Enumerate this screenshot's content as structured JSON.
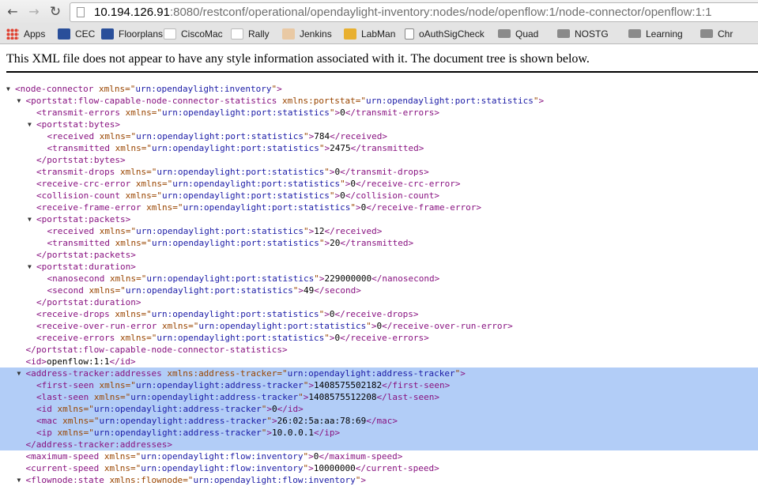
{
  "browser": {
    "url_host": "10.194.126.91",
    "url_rest": ":8080/restconf/operational/opendaylight-inventory:nodes/node/openflow:1/node-connector/openflow:1:1"
  },
  "bookmarks": [
    {
      "label": "Apps",
      "icon": "apps-grid-icon"
    },
    {
      "label": "CEC",
      "icon": "cec-icon"
    },
    {
      "label": "Floorplans",
      "icon": "cec-icon"
    },
    {
      "label": "CiscoMac",
      "icon": "cisco-icon"
    },
    {
      "label": "Rally",
      "icon": "cisco-icon"
    },
    {
      "label": "Jenkins",
      "icon": "jenkins-icon"
    },
    {
      "label": "LabMan",
      "icon": "labman-icon"
    },
    {
      "label": "oAuthSigCheck",
      "icon": "page-icon"
    },
    {
      "label": "Quad",
      "icon": "folder-icon"
    },
    {
      "label": "NOSTG",
      "icon": "folder-icon"
    },
    {
      "label": "Learning",
      "icon": "folder-icon"
    },
    {
      "label": "Chr",
      "icon": "folder-icon"
    }
  ],
  "notice": "This XML file does not appear to have any style information associated with it. The document tree is shown below.",
  "xml_lines": [
    {
      "d": 0,
      "tog": "▼",
      "open": "node-connector",
      "attr": "xmlns",
      "val": "urn:opendaylight:inventory"
    },
    {
      "d": 1,
      "tog": "▼",
      "open": "portstat:flow-capable-node-connector-statistics",
      "attr": "xmlns:portstat",
      "val": "urn:opendaylight:port:statistics"
    },
    {
      "d": 2,
      "open": "transmit-errors",
      "attr": "xmlns",
      "val": "urn:opendaylight:port:statistics",
      "text": "0",
      "close": "transmit-errors"
    },
    {
      "d": 2,
      "tog": "▼",
      "open": "portstat:bytes"
    },
    {
      "d": 3,
      "open": "received",
      "attr": "xmlns",
      "val": "urn:opendaylight:port:statistics",
      "text": "784",
      "close": "received"
    },
    {
      "d": 3,
      "open": "transmitted",
      "attr": "xmlns",
      "val": "urn:opendaylight:port:statistics",
      "text": "2475",
      "close": "transmitted"
    },
    {
      "d": 2,
      "close": "portstat:bytes"
    },
    {
      "d": 2,
      "open": "transmit-drops",
      "attr": "xmlns",
      "val": "urn:opendaylight:port:statistics",
      "text": "0",
      "close": "transmit-drops"
    },
    {
      "d": 2,
      "open": "receive-crc-error",
      "attr": "xmlns",
      "val": "urn:opendaylight:port:statistics",
      "text": "0",
      "close": "receive-crc-error"
    },
    {
      "d": 2,
      "open": "collision-count",
      "attr": "xmlns",
      "val": "urn:opendaylight:port:statistics",
      "text": "0",
      "close": "collision-count"
    },
    {
      "d": 2,
      "open": "receive-frame-error",
      "attr": "xmlns",
      "val": "urn:opendaylight:port:statistics",
      "text": "0",
      "close": "receive-frame-error"
    },
    {
      "d": 2,
      "tog": "▼",
      "open": "portstat:packets"
    },
    {
      "d": 3,
      "open": "received",
      "attr": "xmlns",
      "val": "urn:opendaylight:port:statistics",
      "text": "12",
      "close": "received"
    },
    {
      "d": 3,
      "open": "transmitted",
      "attr": "xmlns",
      "val": "urn:opendaylight:port:statistics",
      "text": "20",
      "close": "transmitted"
    },
    {
      "d": 2,
      "close": "portstat:packets"
    },
    {
      "d": 2,
      "tog": "▼",
      "open": "portstat:duration"
    },
    {
      "d": 3,
      "open": "nanosecond",
      "attr": "xmlns",
      "val": "urn:opendaylight:port:statistics",
      "text": "229000000",
      "close": "nanosecond"
    },
    {
      "d": 3,
      "open": "second",
      "attr": "xmlns",
      "val": "urn:opendaylight:port:statistics",
      "text": "49",
      "close": "second"
    },
    {
      "d": 2,
      "close": "portstat:duration"
    },
    {
      "d": 2,
      "open": "receive-drops",
      "attr": "xmlns",
      "val": "urn:opendaylight:port:statistics",
      "text": "0",
      "close": "receive-drops"
    },
    {
      "d": 2,
      "open": "receive-over-run-error",
      "attr": "xmlns",
      "val": "urn:opendaylight:port:statistics",
      "text": "0",
      "close": "receive-over-run-error"
    },
    {
      "d": 2,
      "open": "receive-errors",
      "attr": "xmlns",
      "val": "urn:opendaylight:port:statistics",
      "text": "0",
      "close": "receive-errors"
    },
    {
      "d": 1,
      "close": "portstat:flow-capable-node-connector-statistics"
    },
    {
      "d": 1,
      "open": "id",
      "text": "openflow:1:1",
      "close": "id"
    },
    {
      "d": 1,
      "tog": "▼",
      "sel": true,
      "open": "address-tracker:addresses",
      "attr": "xmlns:address-tracker",
      "val": "urn:opendaylight:address-tracker"
    },
    {
      "d": 2,
      "sel": true,
      "open": "first-seen",
      "attr": "xmlns",
      "val": "urn:opendaylight:address-tracker",
      "text": "1408575502182",
      "close": "first-seen"
    },
    {
      "d": 2,
      "sel": true,
      "open": "last-seen",
      "attr": "xmlns",
      "val": "urn:opendaylight:address-tracker",
      "text": "1408575512208",
      "close": "last-seen"
    },
    {
      "d": 2,
      "sel": true,
      "open": "id",
      "attr": "xmlns",
      "val": "urn:opendaylight:address-tracker",
      "text": "0",
      "close": "id"
    },
    {
      "d": 2,
      "sel": true,
      "open": "mac",
      "attr": "xmlns",
      "val": "urn:opendaylight:address-tracker",
      "text": "26:02:5a:aa:78:69",
      "close": "mac"
    },
    {
      "d": 2,
      "sel": true,
      "open": "ip",
      "attr": "xmlns",
      "val": "urn:opendaylight:address-tracker",
      "text": "10.0.0.1",
      "close": "ip"
    },
    {
      "d": 1,
      "sel": true,
      "close": "address-tracker:addresses"
    },
    {
      "d": 1,
      "open": "maximum-speed",
      "attr": "xmlns",
      "val": "urn:opendaylight:flow:inventory",
      "text": "0",
      "close": "maximum-speed"
    },
    {
      "d": 1,
      "open": "current-speed",
      "attr": "xmlns",
      "val": "urn:opendaylight:flow:inventory",
      "text": "10000000",
      "close": "current-speed"
    },
    {
      "d": 1,
      "tog": "▼",
      "open": "flownode:state",
      "attr": "xmlns:flownode",
      "val": "urn:opendaylight:flow:inventory"
    }
  ]
}
